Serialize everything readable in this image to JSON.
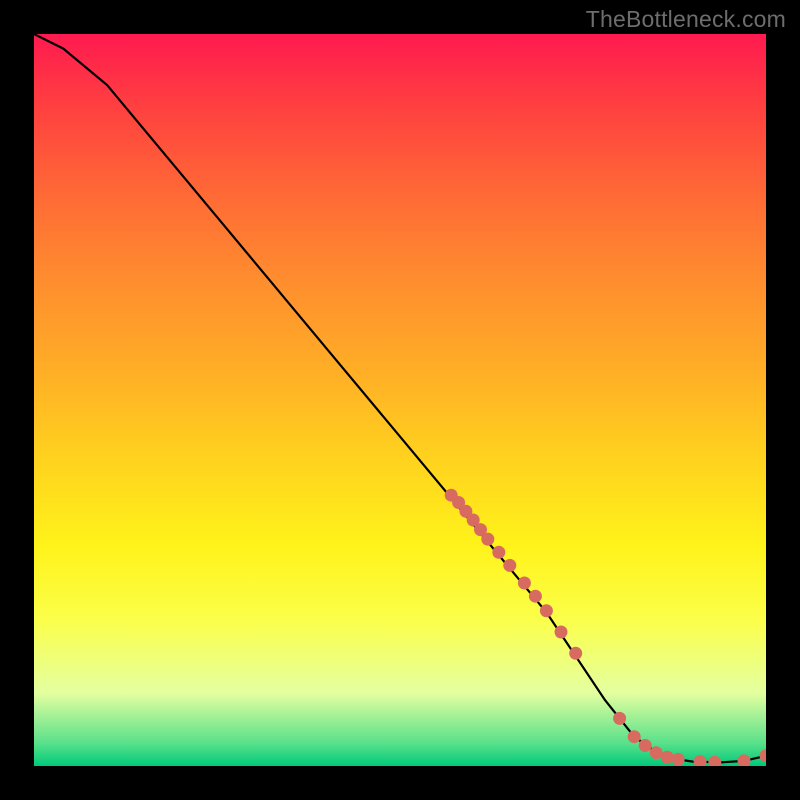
{
  "watermark": "TheBottleneck.com",
  "chart_data": {
    "type": "line",
    "title": "",
    "xlabel": "",
    "ylabel": "",
    "xlim": [
      0,
      100
    ],
    "ylim": [
      0,
      100
    ],
    "curve": {
      "name": "bottleneck-curve",
      "x": [
        0,
        4,
        10,
        20,
        30,
        40,
        50,
        60,
        70,
        78,
        82,
        86,
        90,
        94,
        97,
        100
      ],
      "y": [
        100,
        98,
        93,
        81,
        69,
        57,
        45,
        33,
        21,
        9,
        4,
        1.2,
        0.6,
        0.5,
        0.7,
        1.4
      ]
    },
    "points": {
      "name": "highlighted-segment",
      "x": [
        57,
        58,
        59,
        60,
        61,
        62,
        63.5,
        65,
        67,
        68.5,
        70,
        72,
        74,
        80,
        82,
        83.5,
        85,
        86.5,
        88,
        91,
        93,
        97,
        100
      ],
      "y": [
        37,
        36,
        34.8,
        33.6,
        32.3,
        31,
        29.2,
        27.4,
        25,
        23.2,
        21.2,
        18.3,
        15.4,
        6.5,
        4,
        2.8,
        1.8,
        1.2,
        0.9,
        0.6,
        0.5,
        0.7,
        1.4
      ],
      "color": "#d86b5f"
    }
  }
}
